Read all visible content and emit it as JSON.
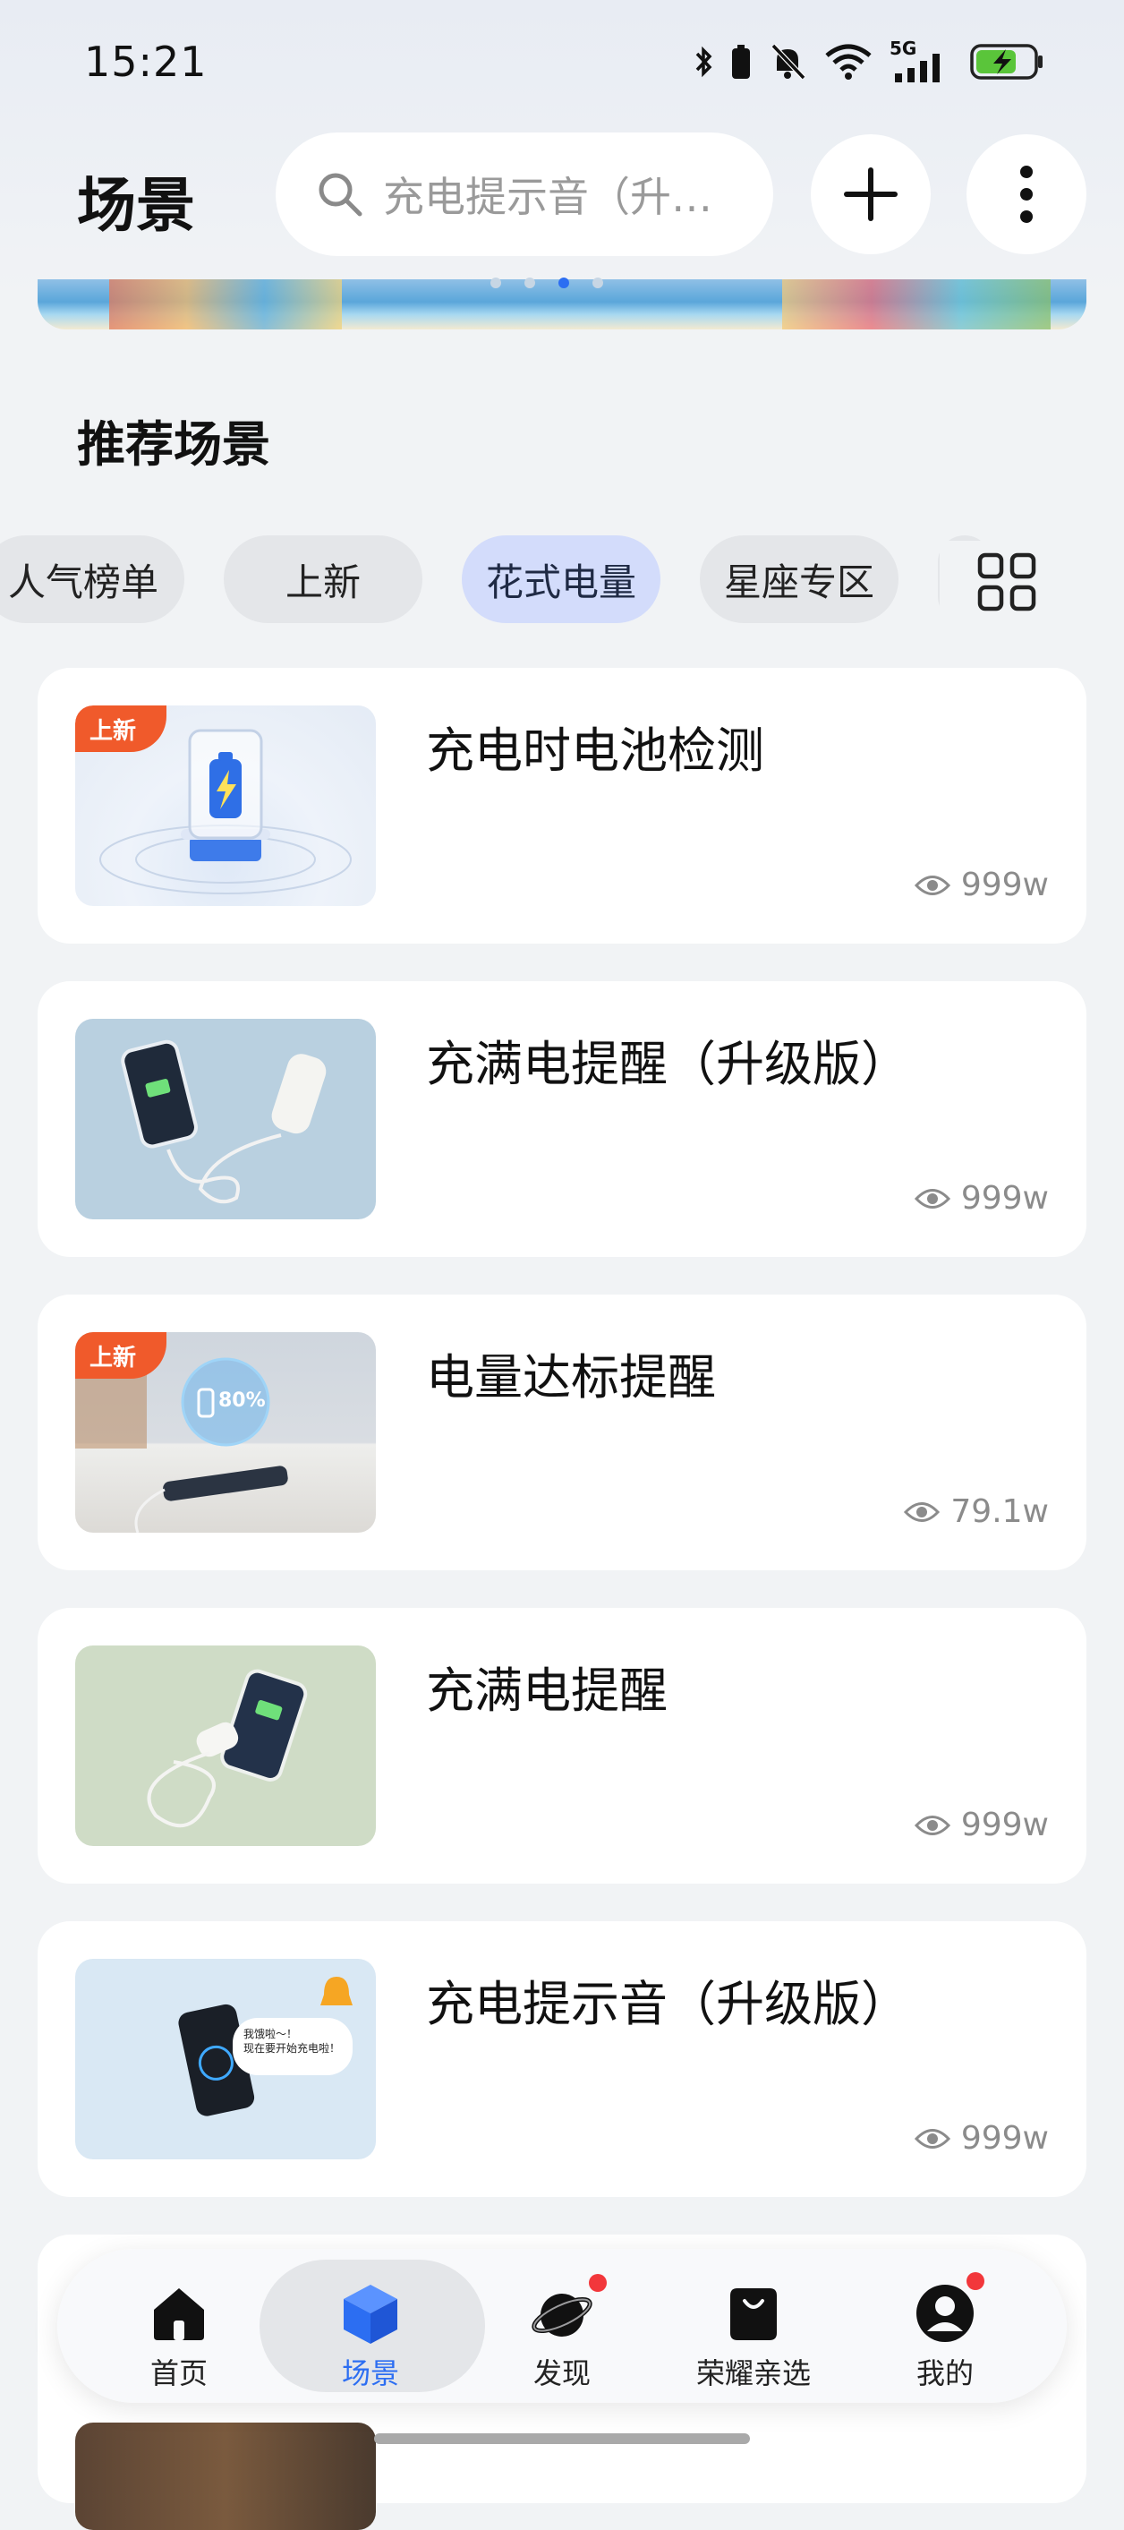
{
  "status_bar": {
    "time": "15:21",
    "network": "5G"
  },
  "header": {
    "title": "场景",
    "search_placeholder": "充电提示音（升…"
  },
  "section_title": "推荐场景",
  "categories": [
    {
      "label": "人气榜单",
      "active": false
    },
    {
      "label": "上新",
      "active": false
    },
    {
      "label": "花式电量",
      "active": true
    },
    {
      "label": "星座专区",
      "active": false
    }
  ],
  "cards": [
    {
      "title": "充电时电池检测",
      "views": "999w",
      "badge": "上新"
    },
    {
      "title": "充满电提醒（升级版）",
      "views": "999w",
      "badge": ""
    },
    {
      "title": "电量达标提醒",
      "views": "79.1w",
      "badge": "上新",
      "thumb_text": "80%"
    },
    {
      "title": "充满电提醒",
      "views": "999w",
      "badge": ""
    },
    {
      "title": "充电提示音（升级版）",
      "views": "999w",
      "badge": "",
      "thumb_text": "我饿啦～！\n现在要开始充电啦！"
    }
  ],
  "bottom_nav": [
    {
      "label": "首页",
      "icon": "home-icon",
      "active": false
    },
    {
      "label": "场景",
      "icon": "scene-cube-icon",
      "active": true
    },
    {
      "label": "发现",
      "icon": "planet-icon",
      "active": false,
      "dot": true
    },
    {
      "label": "荣耀亲选",
      "icon": "shopping-bag-icon",
      "active": false
    },
    {
      "label": "我的",
      "icon": "user-icon",
      "active": false,
      "dot": true
    }
  ],
  "colors": {
    "accent": "#2c6ef2",
    "badge": "#f05a2b",
    "chip_active": "#d3dcfb",
    "background": "#f1f3f5"
  }
}
